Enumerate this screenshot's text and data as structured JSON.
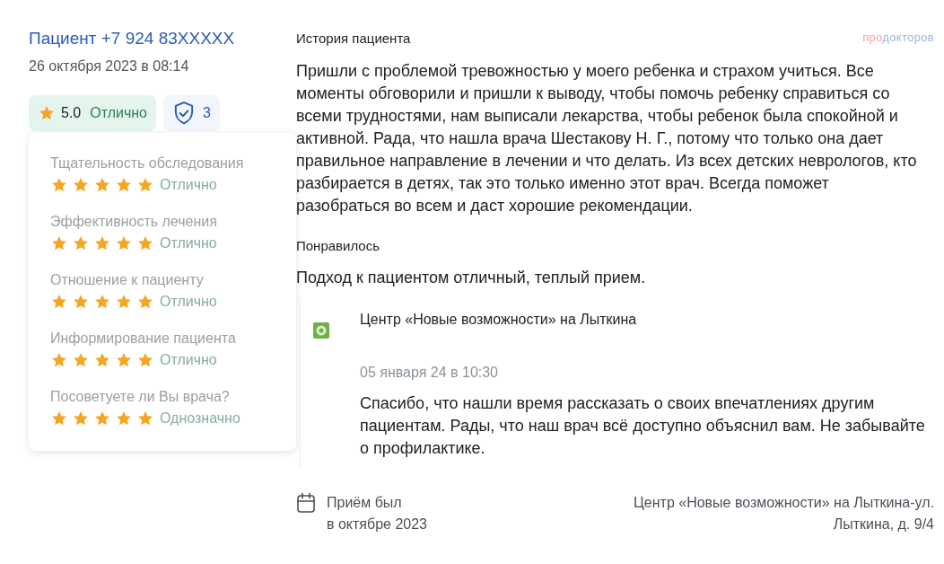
{
  "author": {
    "name": "Пациент +7 924 83XXXXX",
    "date": "26 октября 2023 в 08:14"
  },
  "rating_badge": {
    "score": "5.0",
    "verdict": "Отлично"
  },
  "verified_badge": {
    "count": "3"
  },
  "ratings": [
    {
      "label": "Тщательность обследования",
      "stars": 5,
      "verdict": "Отлично"
    },
    {
      "label": "Эффективность лечения",
      "stars": 5,
      "verdict": "Отлично"
    },
    {
      "label": "Отношение к пациенту",
      "stars": 5,
      "verdict": "Отлично"
    },
    {
      "label": "Информирование пациента",
      "stars": 5,
      "verdict": "Отлично"
    },
    {
      "label": "Посоветуете ли Вы врача?",
      "stars": 5,
      "verdict": "Однозначно"
    }
  ],
  "logo": {
    "prefix": "про",
    "suffix": "докторов"
  },
  "history": {
    "title": "История пациента",
    "text": "Пришли с проблемой тревожностью у моего ребенка и страхом учиться. Все моменты обговорили и пришли к выводу, чтобы помочь ребенку справиться со всеми трудностями, нам выписали лекарства, чтобы ребенок была спокойной и активной. Рада, что нашла врача Шестакову Н. Г., потому что только она дает правильное направление в лечении и что делать. Из всех детских неврологов, кто разбирается в детях, так это только именно этот врач. Всегда поможет разобраться во всем и даст хорошие рекомендации."
  },
  "liked": {
    "title": "Понравилось",
    "text": "Подход к пациентом отличный, теплый прием."
  },
  "reply": {
    "organization": "Центр «Новые возможности» на Лыткина",
    "date": "05 января 24 в 10:30",
    "text": "Спасибо, что нашли время рассказать о своих впечатлениях другим пациентам. Рады, что наш врач всё доступно объяснил вам. Не забывайте о профилактике."
  },
  "visit": {
    "line_1": "Приём был",
    "line_2": "в октябре 2023"
  },
  "clinic": {
    "line_1": "Центр «Новые возможности» на Лыткина-ул.",
    "line_2": "Лыткина, д. 9/4"
  }
}
